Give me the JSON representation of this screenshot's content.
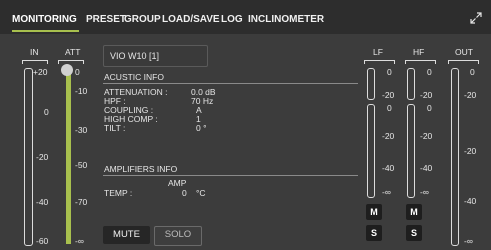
{
  "tabs": [
    {
      "label": "MONITORING",
      "active": true
    },
    {
      "label": "PRESET",
      "active": false
    },
    {
      "label": "GROUP",
      "active": false
    },
    {
      "label": "LOAD/SAVE",
      "active": false
    },
    {
      "label": "LOG",
      "active": false
    },
    {
      "label": "INCLINOMETER",
      "active": false
    }
  ],
  "accent_color": "#a8c04e",
  "headers": {
    "in": "IN",
    "att": "ATT",
    "lf": "LF",
    "hf": "HF",
    "out": "OUT"
  },
  "in_scale": [
    "+20",
    "0",
    "-20",
    "-40",
    "-60"
  ],
  "att_scale": [
    "0",
    "-10",
    "-30",
    "-50",
    "-70",
    "-∞"
  ],
  "lf_scale": [
    "0",
    "-20",
    "0",
    "-20",
    "-40",
    "-∞"
  ],
  "hf_scale": [
    "0",
    "-20",
    "0",
    "-20",
    "-40",
    "-∞"
  ],
  "out_scale": [
    "0",
    "-20",
    "-20",
    "-40",
    "-∞"
  ],
  "device": {
    "name": "VIO W10 [1]"
  },
  "acoustic": {
    "title": "ACUSTIC INFO",
    "rows": [
      {
        "label": "ATTENUATION :",
        "value": "0.0 dB"
      },
      {
        "label": "HPF :",
        "value": "70 Hz"
      },
      {
        "label": "COUPLING :",
        "value": "A"
      },
      {
        "label": "HIGH COMP :",
        "value": "1"
      },
      {
        "label": "TILT :",
        "value": "0 °"
      }
    ]
  },
  "amplifiers": {
    "title": "AMPLIFIERS INFO",
    "col": "AMP",
    "temp_label": "TEMP :",
    "temp_value": "0",
    "temp_unit": "°C"
  },
  "buttons": {
    "mute": "MUTE",
    "solo": "SOLO",
    "m": "M",
    "s": "S"
  },
  "icons": {
    "expand": "expand-icon"
  }
}
